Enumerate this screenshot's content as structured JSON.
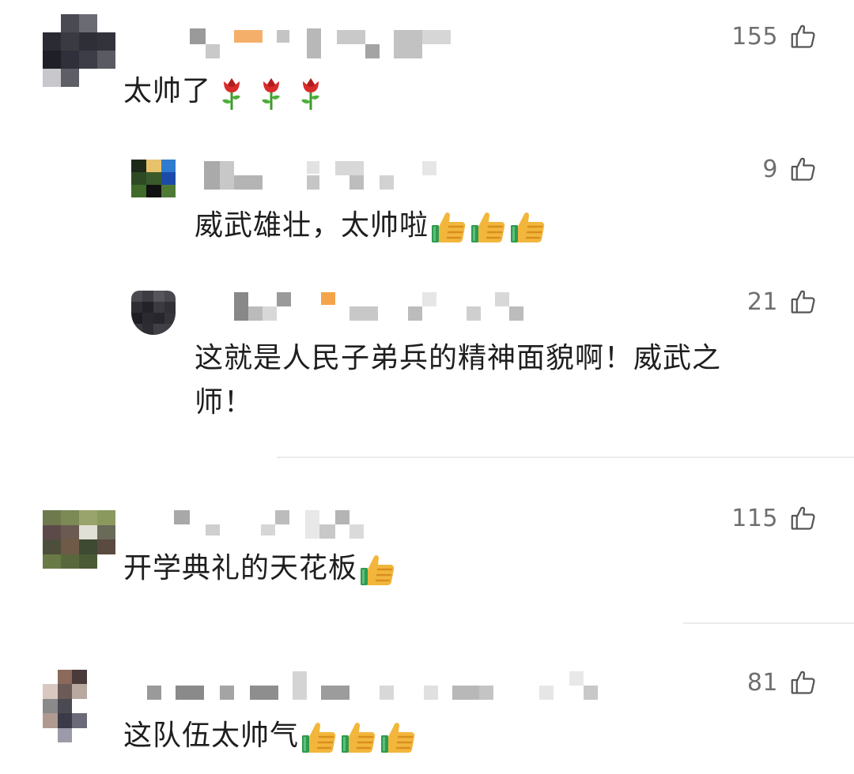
{
  "comments": [
    {
      "id": "c1",
      "likes": "155",
      "text": "太帅了",
      "emoji": [
        "rose",
        "rose",
        "rose"
      ]
    },
    {
      "id": "r1",
      "likes": "9",
      "text": "威武雄壮，太帅啦",
      "emoji": [
        "thumbs-up",
        "thumbs-up",
        "thumbs-up"
      ]
    },
    {
      "id": "r2",
      "likes": "21",
      "text_line1": "这就是人民子弟兵的精神面貌啊！威武之",
      "text_line2": "师！"
    },
    {
      "id": "c2",
      "likes": "115",
      "text": "开学典礼的天花板",
      "emoji": [
        "thumbs-up"
      ]
    },
    {
      "id": "c3",
      "likes": "81",
      "text": "这队伍太帅气",
      "emoji": [
        "thumbs-up",
        "thumbs-up",
        "thumbs-up"
      ]
    }
  ],
  "icons": {
    "like": "thumbs-up-outline-icon",
    "rose": "rose-emoji",
    "thumb": "thumbs-up-emoji"
  },
  "colors": {
    "like_text": "#6f6f6f",
    "comment_text": "#1e1e1e",
    "divider": "#ececec"
  }
}
